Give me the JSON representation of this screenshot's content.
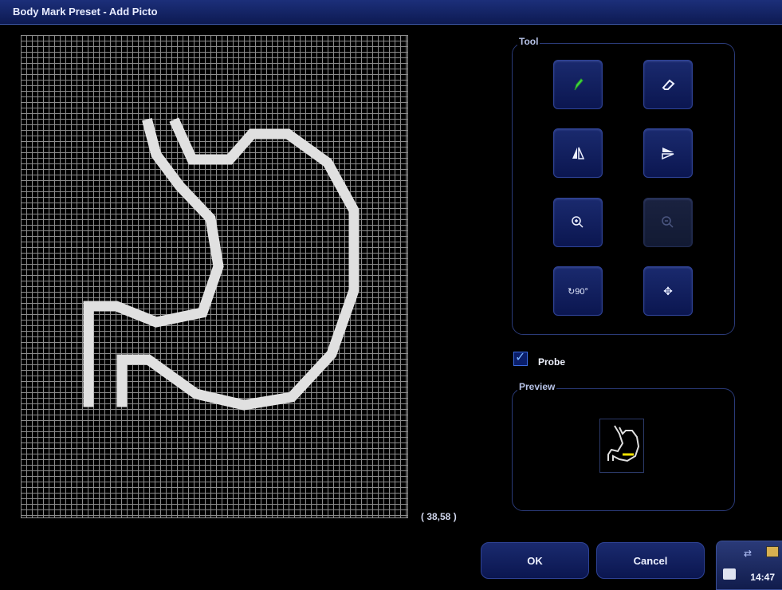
{
  "window": {
    "title": "Body Mark Preset - Add Picto"
  },
  "canvas": {
    "cursor_coords": "( 38,58 )"
  },
  "tool_panel": {
    "title": "Tool",
    "buttons": [
      {
        "name": "pencil-button",
        "icon": "pencil-icon",
        "enabled": true
      },
      {
        "name": "eraser-button",
        "icon": "eraser-icon",
        "enabled": true
      },
      {
        "name": "flip-horizontal-button",
        "icon": "flip-horizontal-icon",
        "enabled": true
      },
      {
        "name": "flip-vertical-button",
        "icon": "flip-vertical-icon",
        "enabled": true
      },
      {
        "name": "zoom-in-button",
        "icon": "zoom-in-icon",
        "enabled": true
      },
      {
        "name": "zoom-out-button",
        "icon": "zoom-out-icon",
        "enabled": false
      },
      {
        "name": "rotate-90-button",
        "icon": "rotate-90-icon",
        "enabled": true
      },
      {
        "name": "move-button",
        "icon": "move-icon",
        "enabled": true
      }
    ],
    "rotate_label": "90°"
  },
  "probe": {
    "label": "Probe",
    "checked": true
  },
  "preview": {
    "title": "Preview"
  },
  "dialog_buttons": {
    "ok": "OK",
    "cancel": "Cancel"
  },
  "status": {
    "time": "14:47",
    "usb_icon": "usb-icon",
    "network_icon": "network-icon",
    "printer_icon": "printer-icon"
  },
  "colors": {
    "pixel": "#e0e0e0",
    "accent": "#1a2a6e",
    "probe_marker": "#f0e000"
  }
}
